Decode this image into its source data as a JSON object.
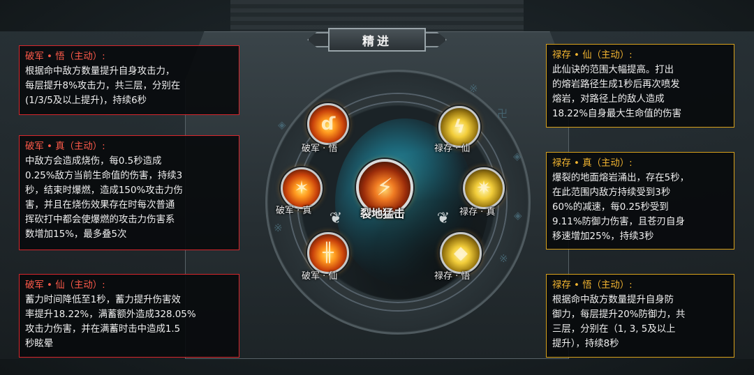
{
  "title": "精进",
  "skills": {
    "center": "裂地猛击",
    "pojun_wu": "破军 · 悟",
    "pojun_zhen": "破军 · 真",
    "pojun_xian": "破军 · 仙",
    "lucun_xian": "禄存 · 仙",
    "lucun_zhen": "禄存 · 真",
    "lucun_wu": "禄存 · 悟"
  },
  "info_boxes": {
    "pojun_wu": {
      "heading": "破军 • 悟（主动）:",
      "body": "根据命中敌方数量提升自身攻击力，\n每层提升8%攻击力，共三层，分别在\n(1/3/5及以上提升)，持续6秒"
    },
    "pojun_zhen": {
      "heading": "破军 • 真（主动）:",
      "body": "中敌方会造成烧伤，每0.5秒造成\n0.25%敌方当前生命值的伤害，持续3\n秒，结束时爆燃，造成150%攻击力伤\n害，并且在烧伤效果存在时每次普通\n挥砍打中都会使爆燃的攻击力伤害系\n数增加15%，最多叠5次"
    },
    "pojun_xian": {
      "heading": "破军 • 仙（主动）:",
      "body": "蓄力时间降低至1秒，蓄力提升伤害效\n率提升18.22%，满蓄额外造成328.05%\n攻击力伤害，并在满蓄时击中造成1.5\n秒眩晕"
    },
    "lucun_xian": {
      "heading": "禄存 • 仙（主动）:",
      "body": "此仙诀的范围大幅提高。打出\n的熔岩路径生成1秒后再次喷发\n熔岩，对路径上的敌人造成\n18.22%自身最大生命值的伤害"
    },
    "lucun_zhen": {
      "heading": "禄存 • 真（主动）:",
      "body": "爆裂的地面熔岩涌出，存在5秒，\n在此范围内敌方持续受到3秒\n60%的减速，每0.25秒受到\n9.11%防御力伤害，且苍刃自身\n移速增加25%，持续3秒"
    },
    "lucun_wu": {
      "heading": "禄存 • 悟（主动）:",
      "body": "根据命中敌方数量提升自身防\n御力，每层提升20%防御力，共\n三层，分别在（1, 3, 5及以上\n提升），持续8秒"
    }
  },
  "colors": {
    "red_border": "#d8262c",
    "gold_border": "#d9a21b",
    "glow": "#3cc8dc"
  }
}
